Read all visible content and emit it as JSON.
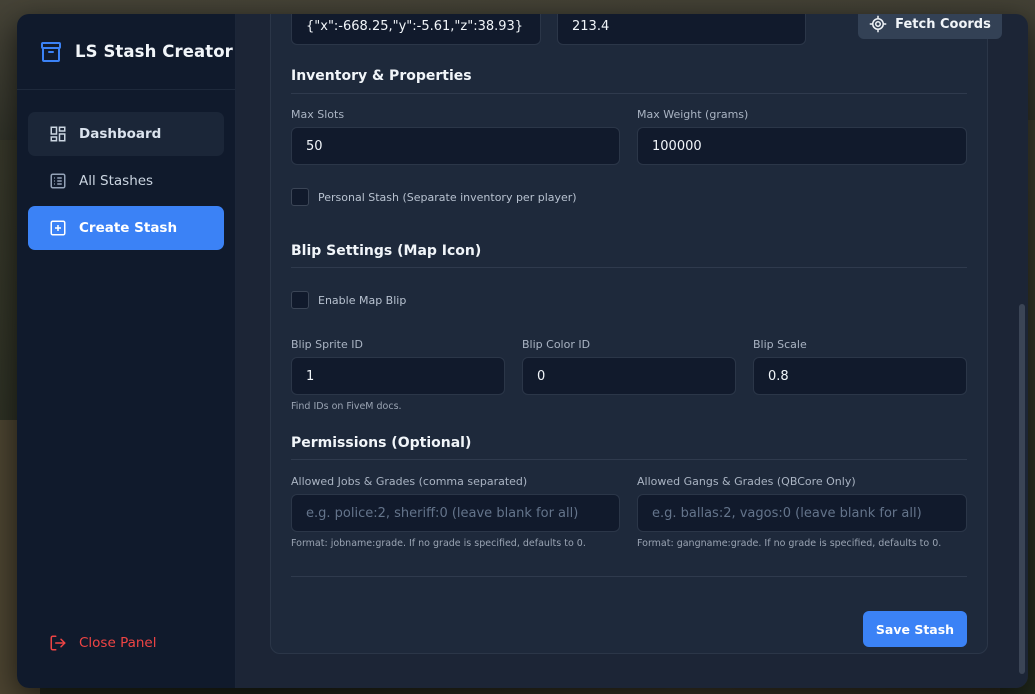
{
  "app": {
    "title": "LS Stash Creator"
  },
  "sidebar": {
    "items": [
      {
        "label": "Dashboard",
        "icon": "dashboard-icon"
      },
      {
        "label": "All Stashes",
        "icon": "list-icon"
      },
      {
        "label": "Create Stash",
        "icon": "plus-square-icon"
      }
    ],
    "close_label": "Close Panel"
  },
  "form": {
    "coords_value": "{\"x\":-668.25,\"y\":-5.61,\"z\":38.93}",
    "heading_value": "213.4",
    "fetch_coords_label": "Fetch Coords",
    "inventory": {
      "title": "Inventory & Properties",
      "max_slots_label": "Max Slots",
      "max_slots_value": "50",
      "max_weight_label": "Max Weight (grams)",
      "max_weight_value": "100000",
      "personal_label": "Personal Stash (Separate inventory per player)"
    },
    "blip": {
      "title": "Blip Settings (Map Icon)",
      "enable_label": "Enable Map Blip",
      "sprite_label": "Blip Sprite ID",
      "sprite_value": "1",
      "sprite_hint": "Find IDs on FiveM docs.",
      "color_label": "Blip Color ID",
      "color_value": "0",
      "scale_label": "Blip Scale",
      "scale_value": "0.8"
    },
    "permissions": {
      "title": "Permissions (Optional)",
      "jobs_label": "Allowed Jobs & Grades (comma separated)",
      "jobs_placeholder": "e.g. police:2, sheriff:0 (leave blank for all)",
      "jobs_hint": "Format: jobname:grade. If no grade is specified, defaults to 0.",
      "gangs_label": "Allowed Gangs & Grades (QBCore Only)",
      "gangs_placeholder": "e.g. ballas:2, vagos:0 (leave blank for all)",
      "gangs_hint": "Format: gangname:grade. If no grade is specified, defaults to 0."
    },
    "save_label": "Save Stash"
  },
  "colors": {
    "accent": "#3b82f6",
    "sidebar_bg": "#101a2c",
    "danger": "#ef4444"
  }
}
